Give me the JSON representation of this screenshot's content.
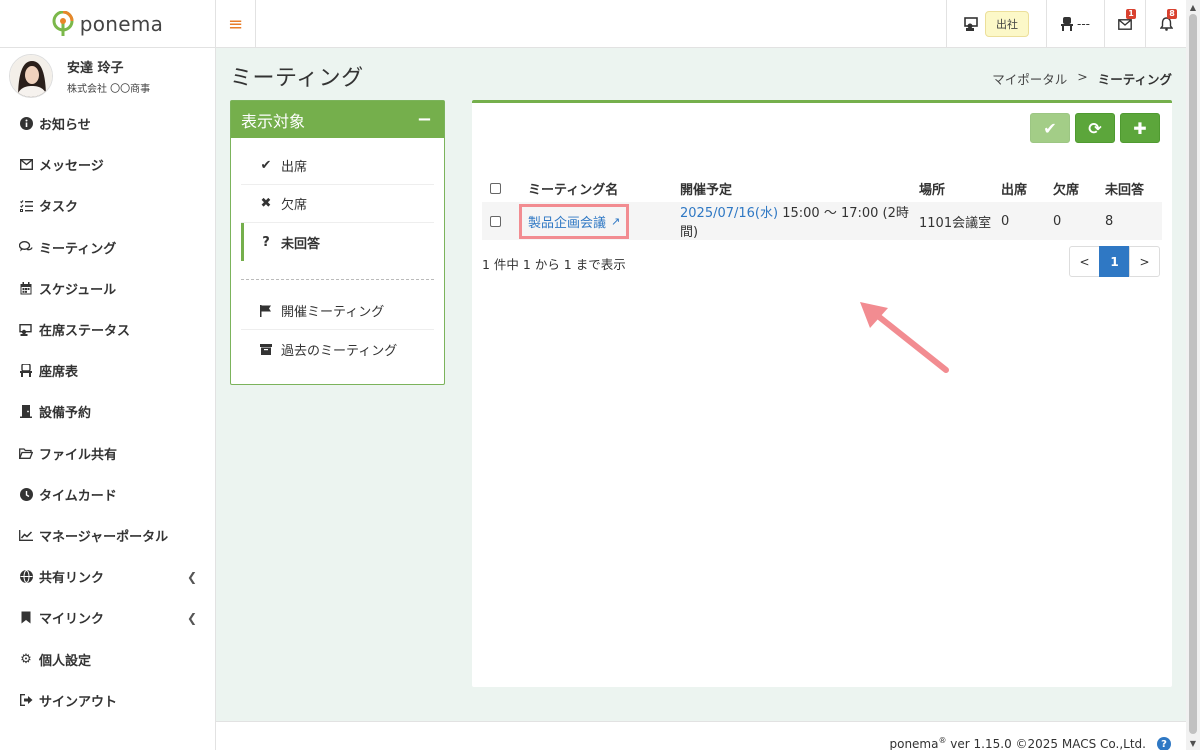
{
  "app": {
    "brand": "ponema"
  },
  "topbar": {
    "menu_icon": "hamburger-icon",
    "status_label": "出社",
    "seat_label": "---",
    "mail_badge": "1",
    "bell_badge": "8"
  },
  "user": {
    "name": "安達 玲子",
    "company": "株式会社 〇〇商事"
  },
  "sidebar": {
    "items": [
      {
        "label": "お知らせ",
        "icon": "info-icon"
      },
      {
        "label": "メッセージ",
        "icon": "envelope-icon"
      },
      {
        "label": "タスク",
        "icon": "task-list-icon"
      },
      {
        "label": "ミーティング",
        "icon": "chat-icon"
      },
      {
        "label": "スケジュール",
        "icon": "calendar-icon"
      },
      {
        "label": "在席ステータス",
        "icon": "presence-icon"
      },
      {
        "label": "座席表",
        "icon": "seat-icon"
      },
      {
        "label": "設備予約",
        "icon": "door-icon"
      },
      {
        "label": "ファイル共有",
        "icon": "folder-icon"
      },
      {
        "label": "タイムカード",
        "icon": "clock-icon"
      },
      {
        "label": "マネージャーポータル",
        "icon": "chart-icon"
      },
      {
        "label": "共有リンク",
        "icon": "globe-icon"
      },
      {
        "label": "マイリンク",
        "icon": "bookmark-icon"
      },
      {
        "label": "個人設定",
        "icon": "gear-icon"
      },
      {
        "label": "サインアウト",
        "icon": "sign-out-icon"
      }
    ]
  },
  "page": {
    "title": "ミーティング",
    "breadcrumb": {
      "parent": "マイポータル",
      "separator": ">",
      "current": "ミーティング"
    }
  },
  "filter": {
    "title": "表示対象",
    "collapse_symbol": "−",
    "items": [
      {
        "label": "出席",
        "icon": "check-icon"
      },
      {
        "label": "欠席",
        "icon": "x-icon"
      },
      {
        "label": "未回答",
        "icon": "question-icon"
      }
    ],
    "links": [
      {
        "label": "開催ミーティング",
        "icon": "flag-icon"
      },
      {
        "label": "過去のミーティング",
        "icon": "archive-icon"
      }
    ]
  },
  "table": {
    "headers": [
      "ミーティング名",
      "開催予定",
      "場所",
      "出席",
      "欠席",
      "未回答"
    ],
    "rows": [
      {
        "name": "製品企画会議",
        "date": "2025/07/16(水)",
        "time": "15:00 〜 17:00 (2時間)",
        "place": "1101会議室",
        "attend": "0",
        "absent": "0",
        "unanswered": "8"
      }
    ]
  },
  "summary": "1 件中 1 から 1 まで表示",
  "pagination": {
    "prev": "<",
    "current": "1",
    "next": ">"
  },
  "footer": {
    "brand": "ponema",
    "reg": "®",
    "rest": " ver 1.15.0 ©2025 MACS Co.,Ltd.",
    "help": "?"
  },
  "colors": {
    "accent_green": "#75af4c",
    "link_blue": "#2f78c4",
    "highlight_pink": "#f28c91",
    "badge_red": "#d9412f"
  }
}
